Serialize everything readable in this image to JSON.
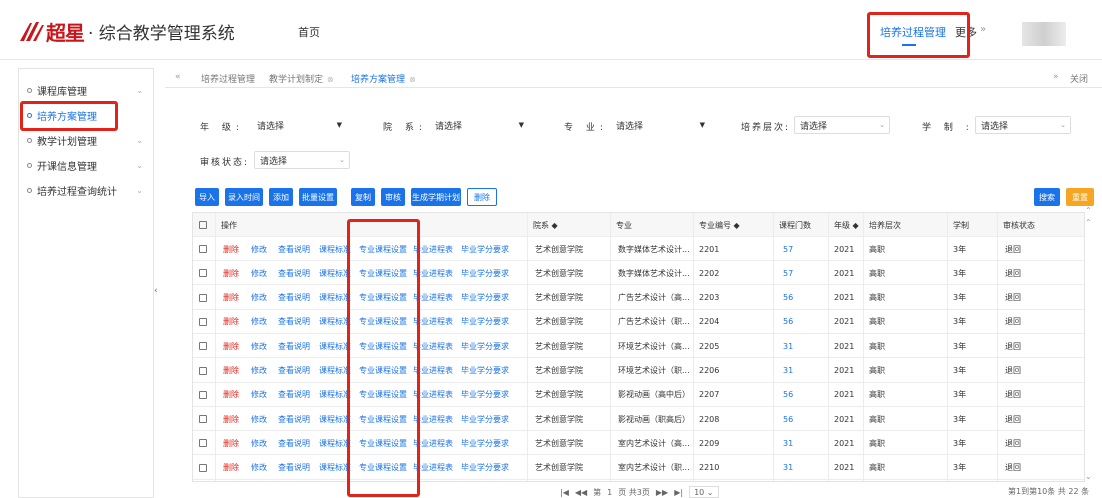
{
  "header": {
    "brand": "超星",
    "title": "· 综合教学管理系统",
    "home": "首页",
    "nav_active": "培养过程管理",
    "nav_more": "更多",
    "nav_more_arrow": "»",
    "accent": "#1a73e8",
    "highlight_color": "#e2231a"
  },
  "sidebar": {
    "items": [
      {
        "label": "课程库管理",
        "chevron": "⌄"
      },
      {
        "label": "培养方案管理",
        "chevron": ""
      },
      {
        "label": "教学计划管理",
        "chevron": "⌄"
      },
      {
        "label": "开课信息管理",
        "chevron": "⌄"
      },
      {
        "label": "培养过程查询统计",
        "chevron": "⌄"
      }
    ],
    "collapse_icon": "‹"
  },
  "tabs": {
    "prev": "«",
    "next": "»",
    "close_all": "关闭",
    "items": [
      {
        "label": "培养过程管理",
        "close": ""
      },
      {
        "label": "教学计划制定",
        "close": "⊗"
      },
      {
        "label": "培养方案管理",
        "close": "⊗"
      }
    ]
  },
  "filters": {
    "grade_label": "年 级:",
    "grade_value": "请选择",
    "dept_label": "院 系:",
    "dept_value": "请选择",
    "major_label": "专 业:",
    "major_value": "请选择",
    "level_label": "培养层次:",
    "level_value": "请选择",
    "duration_label": "学 制 :",
    "duration_value": "请选择",
    "status_label": "审核状态:",
    "status_value": "请选择"
  },
  "buttons": {
    "import": "导入",
    "entry_time": "录入时间",
    "add": "添加",
    "batch_set": "批量设置",
    "copy": "复制",
    "audit": "审核",
    "gen_plan": "生成学期计划",
    "delete": "删除",
    "search": "搜索",
    "reset": "重置"
  },
  "table": {
    "headers": {
      "op": "操作",
      "dept": "院系 ◆",
      "major": "专业",
      "major_code": "专业编号 ◆",
      "course_count": "课程门数",
      "grade": "年级 ◆",
      "level": "培养层次",
      "duration": "学制",
      "status": "审核状态"
    },
    "ops": [
      "删除",
      "修改",
      "查看说明",
      "课程标准",
      "专业课程设置",
      "毕业进程表",
      "毕业学分要求"
    ],
    "rows": [
      {
        "dept": "艺术创意学院",
        "major": "数字媒体艺术设计...",
        "code": "2201",
        "count": "57",
        "grade": "2021",
        "level": "高职",
        "duration": "3年",
        "status": "退回"
      },
      {
        "dept": "艺术创意学院",
        "major": "数字媒体艺术设计...",
        "code": "2202",
        "count": "57",
        "grade": "2021",
        "level": "高职",
        "duration": "3年",
        "status": "退回"
      },
      {
        "dept": "艺术创意学院",
        "major": "广告艺术设计（高...",
        "code": "2203",
        "count": "56",
        "grade": "2021",
        "level": "高职",
        "duration": "3年",
        "status": "退回"
      },
      {
        "dept": "艺术创意学院",
        "major": "广告艺术设计（职...",
        "code": "2204",
        "count": "56",
        "grade": "2021",
        "level": "高职",
        "duration": "3年",
        "status": "退回"
      },
      {
        "dept": "艺术创意学院",
        "major": "环境艺术设计（高...",
        "code": "2205",
        "count": "31",
        "grade": "2021",
        "level": "高职",
        "duration": "3年",
        "status": "退回"
      },
      {
        "dept": "艺术创意学院",
        "major": "环境艺术设计（职...",
        "code": "2206",
        "count": "31",
        "grade": "2021",
        "level": "高职",
        "duration": "3年",
        "status": "退回"
      },
      {
        "dept": "艺术创意学院",
        "major": "影视动画（高中后）",
        "code": "2207",
        "count": "56",
        "grade": "2021",
        "level": "高职",
        "duration": "3年",
        "status": "退回"
      },
      {
        "dept": "艺术创意学院",
        "major": "影视动画（职高后）",
        "code": "2208",
        "count": "56",
        "grade": "2021",
        "level": "高职",
        "duration": "3年",
        "status": "退回"
      },
      {
        "dept": "艺术创意学院",
        "major": "室内艺术设计（高...",
        "code": "2209",
        "count": "31",
        "grade": "2021",
        "level": "高职",
        "duration": "3年",
        "status": "退回"
      },
      {
        "dept": "艺术创意学院",
        "major": "室内艺术设计（职...",
        "code": "2210",
        "count": "31",
        "grade": "2021",
        "level": "高职",
        "duration": "3年",
        "status": "退回"
      }
    ]
  },
  "pager": {
    "first": "|◀",
    "prev": "◀◀",
    "page_prefix": "第",
    "page_no": "1",
    "page_suffix": "页 共3页",
    "next": "▶▶",
    "last": "▶|",
    "page_size": "10 ⌄",
    "summary": "第1到第10条 共 22 条"
  }
}
